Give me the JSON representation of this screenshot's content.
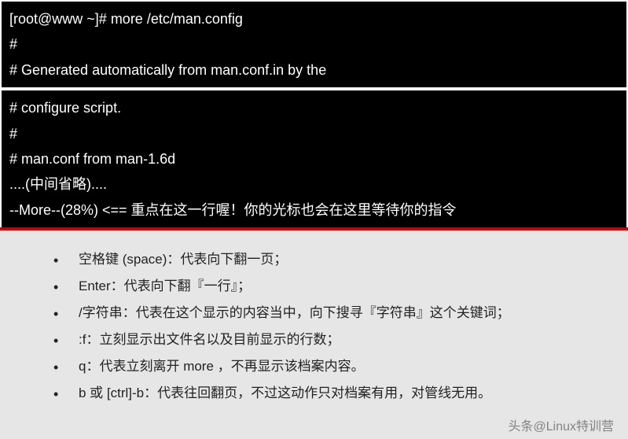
{
  "terminal_top": {
    "line1": "[root@www ~]# more /etc/man.config",
    "line2": "#",
    "line3": "# Generated automatically from man.conf.in by the"
  },
  "terminal_bottom": {
    "line1": "# configure script.",
    "line2": "#",
    "line3": "# man.conf from man-1.6d",
    "line4": "....(中间省略)....",
    "line5": "--More--(28%)  <== 重点在这一行喔！你的光标也会在这里等待你的指令"
  },
  "items": [
    {
      "key": "空格键 (space)",
      "desc": "：代表向下翻一页；"
    },
    {
      "key": "Enter           ",
      "desc": "：代表向下翻『一行』；"
    },
    {
      "key": "/字符串          ",
      "desc": "：代表在这个显示的内容当中，向下搜寻『字符串』这个关键词；"
    },
    {
      "key": ":f               ",
      "desc": "：立刻显示出文件名以及目前显示的行数；"
    },
    {
      "key": "q                ",
      "desc": "：代表立刻离开 more ，不再显示该档案内容。"
    },
    {
      "key": "b 或 [ctrl]-b ",
      "desc": "：代表往回翻页，不过这动作只对档案有用，对管线无用。"
    }
  ],
  "watermark": "头条@Linux特训营"
}
